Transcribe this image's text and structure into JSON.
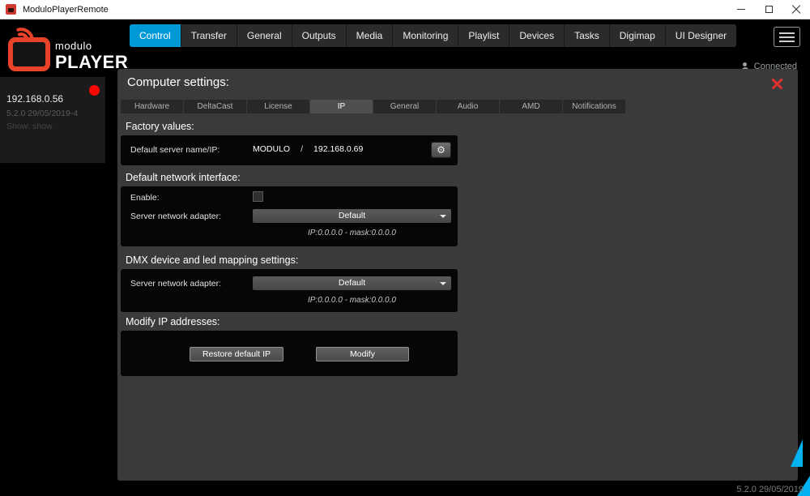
{
  "window": {
    "title": "ModuloPlayerRemote"
  },
  "logo": {
    "line1": "modulo",
    "line2": "PLAYER"
  },
  "main_tabs": [
    {
      "label": "Control",
      "active": true
    },
    {
      "label": "Transfer",
      "active": false
    },
    {
      "label": "General",
      "active": false
    },
    {
      "label": "Outputs",
      "active": false
    },
    {
      "label": "Media",
      "active": false
    },
    {
      "label": "Monitoring",
      "active": false
    },
    {
      "label": "Playlist",
      "active": false
    },
    {
      "label": "Devices",
      "active": false
    },
    {
      "label": "Tasks",
      "active": false
    },
    {
      "label": "Digimap",
      "active": false
    },
    {
      "label": "UI Designer",
      "active": false
    }
  ],
  "status": {
    "connected_label": "Connected"
  },
  "sidebar": {
    "server": {
      "ip": "192.168.0.56",
      "version": "5.2.0 29/05/2019-4",
      "show_line": "Show: show"
    }
  },
  "panel": {
    "title": "Computer settings:",
    "subtabs": [
      {
        "label": "Hardware",
        "active": false
      },
      {
        "label": "DeltaCast",
        "active": false
      },
      {
        "label": "License",
        "active": false
      },
      {
        "label": "IP",
        "active": true
      },
      {
        "label": "General",
        "active": false
      },
      {
        "label": "Audio",
        "active": false
      },
      {
        "label": "AMD",
        "active": false
      },
      {
        "label": "Notifications",
        "active": false
      }
    ],
    "factory": {
      "heading": "Factory values:",
      "label": "Default server name/IP:",
      "server_name": "MODULO",
      "separator": "/",
      "server_ip": "192.168.0.69"
    },
    "network": {
      "heading": "Default network interface:",
      "enable_label": "Enable:",
      "adapter_label": "Server network adapter:",
      "adapter_value": "Default",
      "ip_mask": "IP:0.0.0.0 - mask:0.0.0.0"
    },
    "dmx": {
      "heading": "DMX device and led mapping settings:",
      "adapter_label": "Server network adapter:",
      "adapter_value": "Default",
      "ip_mask": "IP:0.0.0.0 - mask:0.0.0.0"
    },
    "modify": {
      "heading": "Modify IP addresses:",
      "restore_label": "Restore default IP",
      "modify_label": "Modify"
    }
  },
  "footer": {
    "version": "5.2.0 29/05/2019"
  },
  "icons": {
    "gear": "⚙"
  },
  "colors": {
    "accent_blue": "#0099d8",
    "logo_red": "#e8432a",
    "alert_red": "#e03131",
    "triangle_cyan": "#00b2f0"
  }
}
